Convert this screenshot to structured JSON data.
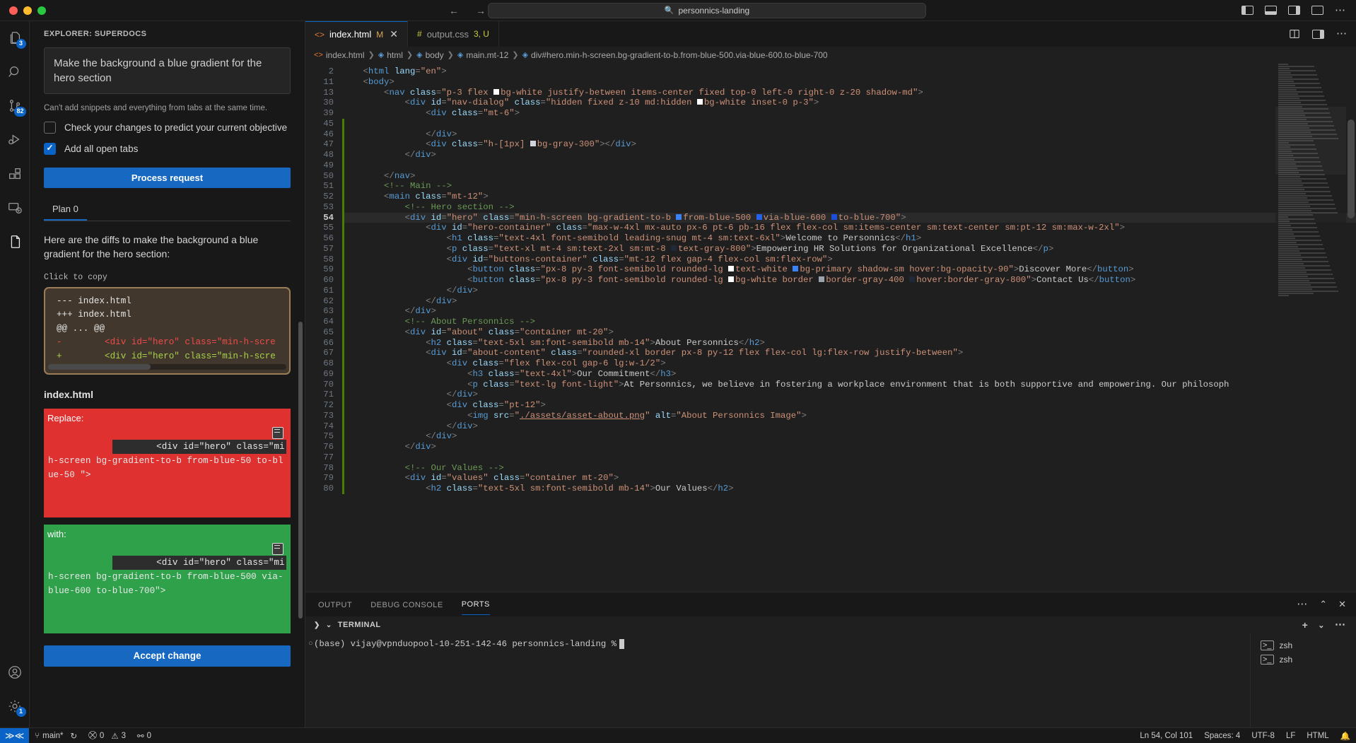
{
  "titlebar": {
    "nav_back": "←",
    "nav_forward": "→",
    "search_text": "personnics-landing",
    "search_icon": "search-icon"
  },
  "activitybar": {
    "items": [
      {
        "name": "explorer",
        "badge": "3"
      },
      {
        "name": "search",
        "badge": ""
      },
      {
        "name": "source-control",
        "badge": "82"
      },
      {
        "name": "run-and-debug",
        "badge": ""
      },
      {
        "name": "extensions",
        "badge": ""
      },
      {
        "name": "remote-explorer",
        "badge": ""
      },
      {
        "name": "superdocs",
        "badge": ""
      }
    ],
    "bottom": [
      {
        "name": "accounts",
        "badge": ""
      },
      {
        "name": "settings",
        "badge": "1"
      }
    ]
  },
  "sidepanel": {
    "title": "EXPLORER: SUPERDOCS",
    "prompt_value": "Make the background a blue gradient for the hero section",
    "hint": "Can't add snippets and everything from tabs at the same time.",
    "checkbox1_label": "Check your changes to predict your current objective",
    "checkbox1_checked": false,
    "checkbox2_label": "Add all open tabs",
    "checkbox2_checked": true,
    "process_button": "Process request",
    "plan_tab": "Plan 0",
    "paragraph": "Here are the diffs to make the background a blue gradient for the hero section:",
    "click_to_copy": "Click to copy",
    "diff_lines": [
      {
        "type": "meta",
        "text": "--- index.html"
      },
      {
        "type": "meta",
        "text": "+++ index.html"
      },
      {
        "type": "meta",
        "text": "@@ ... @@"
      },
      {
        "type": "minus",
        "text": "-        <div id=\"hero\" class=\"min-h-scre"
      },
      {
        "type": "plus",
        "text": "+        <div id=\"hero\" class=\"min-h-scre"
      }
    ],
    "file_label": "index.html",
    "replace_label": "Replace:",
    "replace_code_first": "        <div id=\"hero\" class=\"mi",
    "replace_code_rest": "h-screen bg-gradient-to-b from-blue-50 to-blue-50 \">",
    "with_label": "with:",
    "with_code_first": "        <div id=\"hero\" class=\"mi",
    "with_code_rest": "h-screen bg-gradient-to-b from-blue-500 via-blue-600 to-blue-700\">",
    "accept_button": "Accept change",
    "copy_icon": "copy-icon"
  },
  "editor": {
    "tabs": [
      {
        "label": "index.html",
        "icon": "html-icon",
        "state": "M",
        "active": true,
        "closable": true
      },
      {
        "label": "output.css",
        "icon": "css-icon",
        "state": "3, U",
        "active": false,
        "closable": false
      }
    ],
    "tab_actions": [
      "split-editor-icon",
      "layout-icon",
      "more-actions-icon"
    ],
    "breadcrumb": [
      "index.html",
      "html",
      "body",
      "main.mt-12",
      "div#hero.min-h-screen.bg-gradient-to-b.from-blue-500.via-blue-600.to-blue-700"
    ],
    "lines": [
      {
        "n": "2",
        "indent": 1,
        "html": "<span class=\"punct\">&lt;</span><span class=\"tagname\">html</span> <span class=\"attr\">lang</span><span class=\"punct\">=</span><span class=\"str\">\"en\"</span><span class=\"punct\">&gt;</span>"
      },
      {
        "n": "11",
        "indent": 1,
        "html": "<span class=\"punct\">&lt;</span><span class=\"tagname\">body</span><span class=\"punct\">&gt;</span>"
      },
      {
        "n": "13",
        "indent": 2,
        "html": "<span class=\"punct\">&lt;</span><span class=\"tagname\">nav</span> <span class=\"attr\">class</span><span class=\"punct\">=</span><span class=\"str\">\"p-3 flex </span><span class=\"sw wh\"></span><span class=\"str\">bg-white justify-between items-center fixed top-0 left-0 right-0 z-20 shadow-md\"</span><span class=\"punct\">&gt;</span>"
      },
      {
        "n": "30",
        "indent": 3,
        "html": "<span class=\"punct\">&lt;</span><span class=\"tagname\">div</span> <span class=\"attr\">id</span><span class=\"punct\">=</span><span class=\"str\">\"nav-dialog\"</span> <span class=\"attr\">class</span><span class=\"punct\">=</span><span class=\"str\">\"hidden fixed z-10 md:hidden </span><span class=\"sw wh\"></span><span class=\"str\">bg-white inset-0 p-3\"</span><span class=\"punct\">&gt;</span>"
      },
      {
        "n": "39",
        "indent": 4,
        "html": "<span class=\"punct\">&lt;</span><span class=\"tagname\">div</span> <span class=\"attr\">class</span><span class=\"punct\">=</span><span class=\"str\">\"mt-6\"</span><span class=\"punct\">&gt;</span>"
      },
      {
        "n": "45",
        "indent": 5,
        "html": ""
      },
      {
        "n": "46",
        "indent": 4,
        "html": "<span class=\"punct\">&lt;/</span><span class=\"tagname\">div</span><span class=\"punct\">&gt;</span>"
      },
      {
        "n": "47",
        "indent": 4,
        "html": "<span class=\"punct\">&lt;</span><span class=\"tagname\">div</span> <span class=\"attr\">class</span><span class=\"punct\">=</span><span class=\"str\">\"h-[1px] </span><span class=\"sw g3\"></span><span class=\"str\">bg-gray-300\"</span><span class=\"punct\">&gt;&lt;/</span><span class=\"tagname\">div</span><span class=\"punct\">&gt;</span>"
      },
      {
        "n": "48",
        "indent": 3,
        "html": "<span class=\"punct\">&lt;/</span><span class=\"tagname\">div</span><span class=\"punct\">&gt;</span>"
      },
      {
        "n": "49",
        "indent": 3,
        "html": ""
      },
      {
        "n": "50",
        "indent": 2,
        "html": "<span class=\"punct\">&lt;/</span><span class=\"tagname\">nav</span><span class=\"punct\">&gt;</span>"
      },
      {
        "n": "51",
        "indent": 2,
        "html": "<span class=\"cmt\">&lt;!-- Main --&gt;</span>"
      },
      {
        "n": "52",
        "indent": 2,
        "html": "<span class=\"punct\">&lt;</span><span class=\"tagname\">main</span> <span class=\"attr\">class</span><span class=\"punct\">=</span><span class=\"str\">\"mt-12\"</span><span class=\"punct\">&gt;</span>"
      },
      {
        "n": "53",
        "indent": 3,
        "html": "<span class=\"cmt\">&lt;!-- Hero section --&gt;</span>"
      },
      {
        "n": "54",
        "indent": 3,
        "cur": true,
        "html": "<span class=\"punct\">&lt;</span><span class=\"tagname\">div</span> <span class=\"attr\">id</span><span class=\"punct\">=</span><span class=\"str\">\"hero\"</span> <span class=\"attr\">class</span><span class=\"punct\">=</span><span class=\"str\">\"min-h-screen bg-gradient-to-b </span><span class=\"sw b5\"></span><span class=\"str\">from-blue-500 </span><span class=\"sw b6\"></span><span class=\"str\">via-blue-600 </span><span class=\"sw b7\"></span><span class=\"str\">to-blue-700\"</span><span class=\"punct\">&gt;</span>"
      },
      {
        "n": "55",
        "indent": 4,
        "html": "<span class=\"punct\">&lt;</span><span class=\"tagname\">div</span> <span class=\"attr\">id</span><span class=\"punct\">=</span><span class=\"str\">\"hero-container\"</span> <span class=\"attr\">class</span><span class=\"punct\">=</span><span class=\"str\">\"max-w-4xl mx-auto px-6 pt-6 pb-16 flex flex-col sm:items-center sm:text-center sm:pt-12 sm:max-w-2xl\"</span><span class=\"punct\">&gt;</span>"
      },
      {
        "n": "56",
        "indent": 5,
        "html": "<span class=\"punct\">&lt;</span><span class=\"tagname\">h1</span> <span class=\"attr\">class</span><span class=\"punct\">=</span><span class=\"str\">\"text-4xl font-semibold leading-snug mt-4 sm:text-6xl\"</span><span class=\"punct\">&gt;</span>Welcome to Personnics<span class=\"punct\">&lt;/</span><span class=\"tagname\">h1</span><span class=\"punct\">&gt;</span>"
      },
      {
        "n": "57",
        "indent": 5,
        "html": "<span class=\"punct\">&lt;</span><span class=\"tagname\">p</span> <span class=\"attr\">class</span><span class=\"punct\">=</span><span class=\"str\">\"text-xl mt-4 sm:text-2xl sm:mt-8 </span><span class=\"sw g8\"></span><span class=\"str\">text-gray-800\"</span><span class=\"punct\">&gt;</span>Empowering HR Solutions for Organizational Excellence<span class=\"punct\">&lt;/</span><span class=\"tagname\">p</span><span class=\"punct\">&gt;</span>"
      },
      {
        "n": "58",
        "indent": 5,
        "html": "<span class=\"punct\">&lt;</span><span class=\"tagname\">div</span> <span class=\"attr\">id</span><span class=\"punct\">=</span><span class=\"str\">\"buttons-container\"</span> <span class=\"attr\">class</span><span class=\"punct\">=</span><span class=\"str\">\"mt-12 flex gap-4 flex-col sm:flex-row\"</span><span class=\"punct\">&gt;</span>"
      },
      {
        "n": "59",
        "indent": 6,
        "html": "<span class=\"punct\">&lt;</span><span class=\"tagname\">button</span> <span class=\"attr\">class</span><span class=\"punct\">=</span><span class=\"str\">\"px-8 py-3 font-semibold rounded-lg </span><span class=\"sw wh\"></span><span class=\"str\">text-white </span><span class=\"sw b5\"></span><span class=\"str\">bg-primary shadow-sm hover:bg-opacity-90\"</span><span class=\"punct\">&gt;</span>Discover More<span class=\"punct\">&lt;/</span><span class=\"tagname\">button</span><span class=\"punct\">&gt;</span>"
      },
      {
        "n": "60",
        "indent": 6,
        "html": "<span class=\"punct\">&lt;</span><span class=\"tagname\">button</span> <span class=\"attr\">class</span><span class=\"punct\">=</span><span class=\"str\">\"px-8 py-3 font-semibold rounded-lg </span><span class=\"sw wh\"></span><span class=\"str\">bg-white border </span><span class=\"sw g4\"></span><span class=\"str\">border-gray-400 </span><span class=\"sw g8\"></span><span class=\"str\">hover:border-gray-800\"</span><span class=\"punct\">&gt;</span>Contact Us<span class=\"punct\">&lt;/</span><span class=\"tagname\">button</span><span class=\"punct\">&gt;</span>"
      },
      {
        "n": "61",
        "indent": 5,
        "html": "<span class=\"punct\">&lt;/</span><span class=\"tagname\">div</span><span class=\"punct\">&gt;</span>"
      },
      {
        "n": "62",
        "indent": 4,
        "html": "<span class=\"punct\">&lt;/</span><span class=\"tagname\">div</span><span class=\"punct\">&gt;</span>"
      },
      {
        "n": "63",
        "indent": 3,
        "html": "<span class=\"punct\">&lt;/</span><span class=\"tagname\">div</span><span class=\"punct\">&gt;</span>"
      },
      {
        "n": "64",
        "indent": 3,
        "html": "<span class=\"cmt\">&lt;!-- About Personnics --&gt;</span>"
      },
      {
        "n": "65",
        "indent": 3,
        "html": "<span class=\"punct\">&lt;</span><span class=\"tagname\">div</span> <span class=\"attr\">id</span><span class=\"punct\">=</span><span class=\"str\">\"about\"</span> <span class=\"attr\">class</span><span class=\"punct\">=</span><span class=\"str\">\"container mt-20\"</span><span class=\"punct\">&gt;</span>"
      },
      {
        "n": "66",
        "indent": 4,
        "html": "<span class=\"punct\">&lt;</span><span class=\"tagname\">h2</span> <span class=\"attr\">class</span><span class=\"punct\">=</span><span class=\"str\">\"text-5xl sm:font-semibold mb-14\"</span><span class=\"punct\">&gt;</span>About Personnics<span class=\"punct\">&lt;/</span><span class=\"tagname\">h2</span><span class=\"punct\">&gt;</span>"
      },
      {
        "n": "67",
        "indent": 4,
        "html": "<span class=\"punct\">&lt;</span><span class=\"tagname\">div</span> <span class=\"attr\">id</span><span class=\"punct\">=</span><span class=\"str\">\"about-content\"</span> <span class=\"attr\">class</span><span class=\"punct\">=</span><span class=\"str\">\"rounded-xl border px-8 py-12 flex flex-col lg:flex-row justify-between\"</span><span class=\"punct\">&gt;</span>"
      },
      {
        "n": "68",
        "indent": 5,
        "html": "<span class=\"punct\">&lt;</span><span class=\"tagname\">div</span> <span class=\"attr\">class</span><span class=\"punct\">=</span><span class=\"str\">\"flex flex-col gap-6 lg:w-1/2\"</span><span class=\"punct\">&gt;</span>"
      },
      {
        "n": "69",
        "indent": 6,
        "html": "<span class=\"punct\">&lt;</span><span class=\"tagname\">h3</span> <span class=\"attr\">class</span><span class=\"punct\">=</span><span class=\"str\">\"text-4xl\"</span><span class=\"punct\">&gt;</span>Our Commitment<span class=\"punct\">&lt;/</span><span class=\"tagname\">h3</span><span class=\"punct\">&gt;</span>"
      },
      {
        "n": "70",
        "indent": 6,
        "html": "<span class=\"punct\">&lt;</span><span class=\"tagname\">p</span> <span class=\"attr\">class</span><span class=\"punct\">=</span><span class=\"str\">\"text-lg font-light\"</span><span class=\"punct\">&gt;</span>At Personnics, we believe in fostering a workplace environment that is both supportive and empowering. Our philosoph"
      },
      {
        "n": "71",
        "indent": 5,
        "html": "<span class=\"punct\">&lt;/</span><span class=\"tagname\">div</span><span class=\"punct\">&gt;</span>"
      },
      {
        "n": "72",
        "indent": 5,
        "html": "<span class=\"punct\">&lt;</span><span class=\"tagname\">div</span> <span class=\"attr\">class</span><span class=\"punct\">=</span><span class=\"str\">\"pt-12\"</span><span class=\"punct\">&gt;</span>"
      },
      {
        "n": "73",
        "indent": 6,
        "html": "<span class=\"punct\">&lt;</span><span class=\"tagname\">img</span> <span class=\"attr\">src</span><span class=\"punct\">=</span><span class=\"str\">\"<u>./assets/asset-about.png</u>\"</span> <span class=\"attr\">alt</span><span class=\"punct\">=</span><span class=\"str\">\"About Personnics Image\"</span><span class=\"punct\">&gt;</span>"
      },
      {
        "n": "74",
        "indent": 5,
        "html": "<span class=\"punct\">&lt;/</span><span class=\"tagname\">div</span><span class=\"punct\">&gt;</span>"
      },
      {
        "n": "75",
        "indent": 4,
        "html": "<span class=\"punct\">&lt;/</span><span class=\"tagname\">div</span><span class=\"punct\">&gt;</span>"
      },
      {
        "n": "76",
        "indent": 3,
        "html": "<span class=\"punct\">&lt;/</span><span class=\"tagname\">div</span><span class=\"punct\">&gt;</span>"
      },
      {
        "n": "77",
        "indent": 3,
        "html": ""
      },
      {
        "n": "78",
        "indent": 3,
        "html": "<span class=\"cmt\">&lt;!-- Our Values --&gt;</span>"
      },
      {
        "n": "79",
        "indent": 3,
        "html": "<span class=\"punct\">&lt;</span><span class=\"tagname\">div</span> <span class=\"attr\">id</span><span class=\"punct\">=</span><span class=\"str\">\"values\"</span> <span class=\"attr\">class</span><span class=\"punct\">=</span><span class=\"str\">\"container mt-20\"</span><span class=\"punct\">&gt;</span>"
      },
      {
        "n": "80",
        "indent": 4,
        "html": "<span class=\"punct\">&lt;</span><span class=\"tagname\">h2</span> <span class=\"attr\">class</span><span class=\"punct\">=</span><span class=\"str\">\"text-5xl sm:font-semibold mb-14\"</span><span class=\"punct\">&gt;</span>Our Values<span class=\"punct\">&lt;/</span><span class=\"tagname\">h2</span><span class=\"punct\">&gt;</span>"
      }
    ]
  },
  "panel": {
    "tabs": [
      {
        "label": "OUTPUT",
        "active": false
      },
      {
        "label": "DEBUG CONSOLE",
        "active": false
      },
      {
        "label": "PORTS",
        "active": true
      }
    ],
    "actions": [
      "more-actions-icon",
      "chevron-up-icon",
      "close-icon"
    ],
    "terminal_title": "TERMINAL",
    "terminal_line": "(base) vijay@vpnduopool-10-251-142-46 personnics-landing %",
    "terminal_tabs": [
      "zsh",
      "zsh"
    ],
    "terminal_actions": [
      "add-terminal-icon",
      "chevron-down-icon",
      "more-actions-icon"
    ]
  },
  "statusbar": {
    "remote_icon": "remote-icon",
    "branch": "main*",
    "sync_icon": "sync-icon",
    "errors": "0",
    "warnings": "3",
    "ports": "0",
    "position": "Ln 54, Col 101",
    "spaces": "Spaces: 4",
    "encoding": "UTF-8",
    "eol": "LF",
    "language": "HTML",
    "bell_icon": "bell-icon"
  },
  "colors": {
    "accent": "#0a64c8",
    "add": "#2fa14a",
    "remove": "#e03131",
    "diff_card_bg": "#41372c",
    "diff_card_border": "#9b7d5a"
  }
}
